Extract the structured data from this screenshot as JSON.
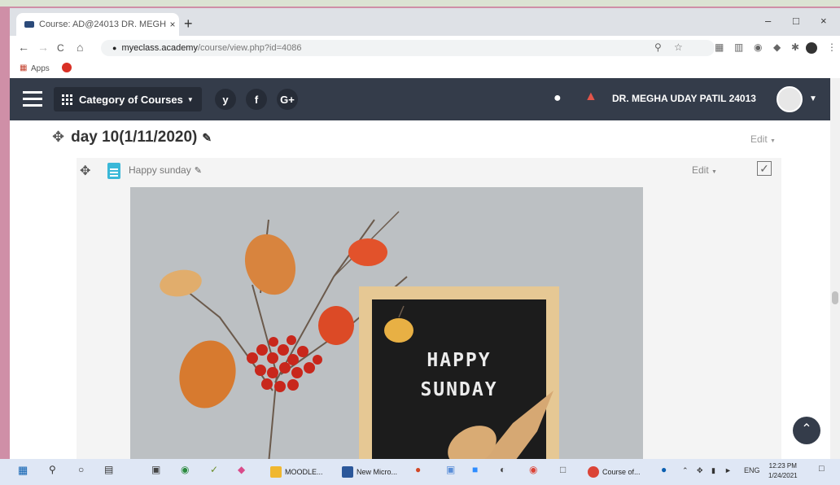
{
  "browser": {
    "tab_title": "Course: AD@24013 DR. MEGHA",
    "tab_close": "×",
    "new_tab": "+",
    "url_domain": "myeclass.academy",
    "url_path": "/course/view.php?id=4086",
    "back": "←",
    "forward": "→",
    "reload": "C",
    "home": "⌂",
    "bookmarks": {
      "apps": "Apps"
    },
    "window_controls": [
      "–",
      "□",
      "×"
    ]
  },
  "navbar": {
    "category_label": "Category of Courses",
    "social": [
      "y",
      "f",
      "G+"
    ],
    "user_name": "DR. MEGHA UDAY PATIL 24013"
  },
  "section": {
    "title": "day 10(1/11/2020)",
    "edit_label": "Edit"
  },
  "activity": {
    "title": "Happy sunday",
    "edit_label": "Edit",
    "check": "✓",
    "image_text_line1": "HAPPY",
    "image_text_line2": "SUNDAY"
  },
  "taskbar": {
    "tasks": [
      "MOODLE...",
      "New Micro...",
      "Course of..."
    ],
    "lang": "ENG",
    "time": "12:23 PM",
    "date": "1/24/2021"
  },
  "colors": {
    "navbar": "#343c4a",
    "accent_doc": "#3ab8d8",
    "wallpaper": "#cf8fa7",
    "letterboard": "#1c1c1c"
  }
}
